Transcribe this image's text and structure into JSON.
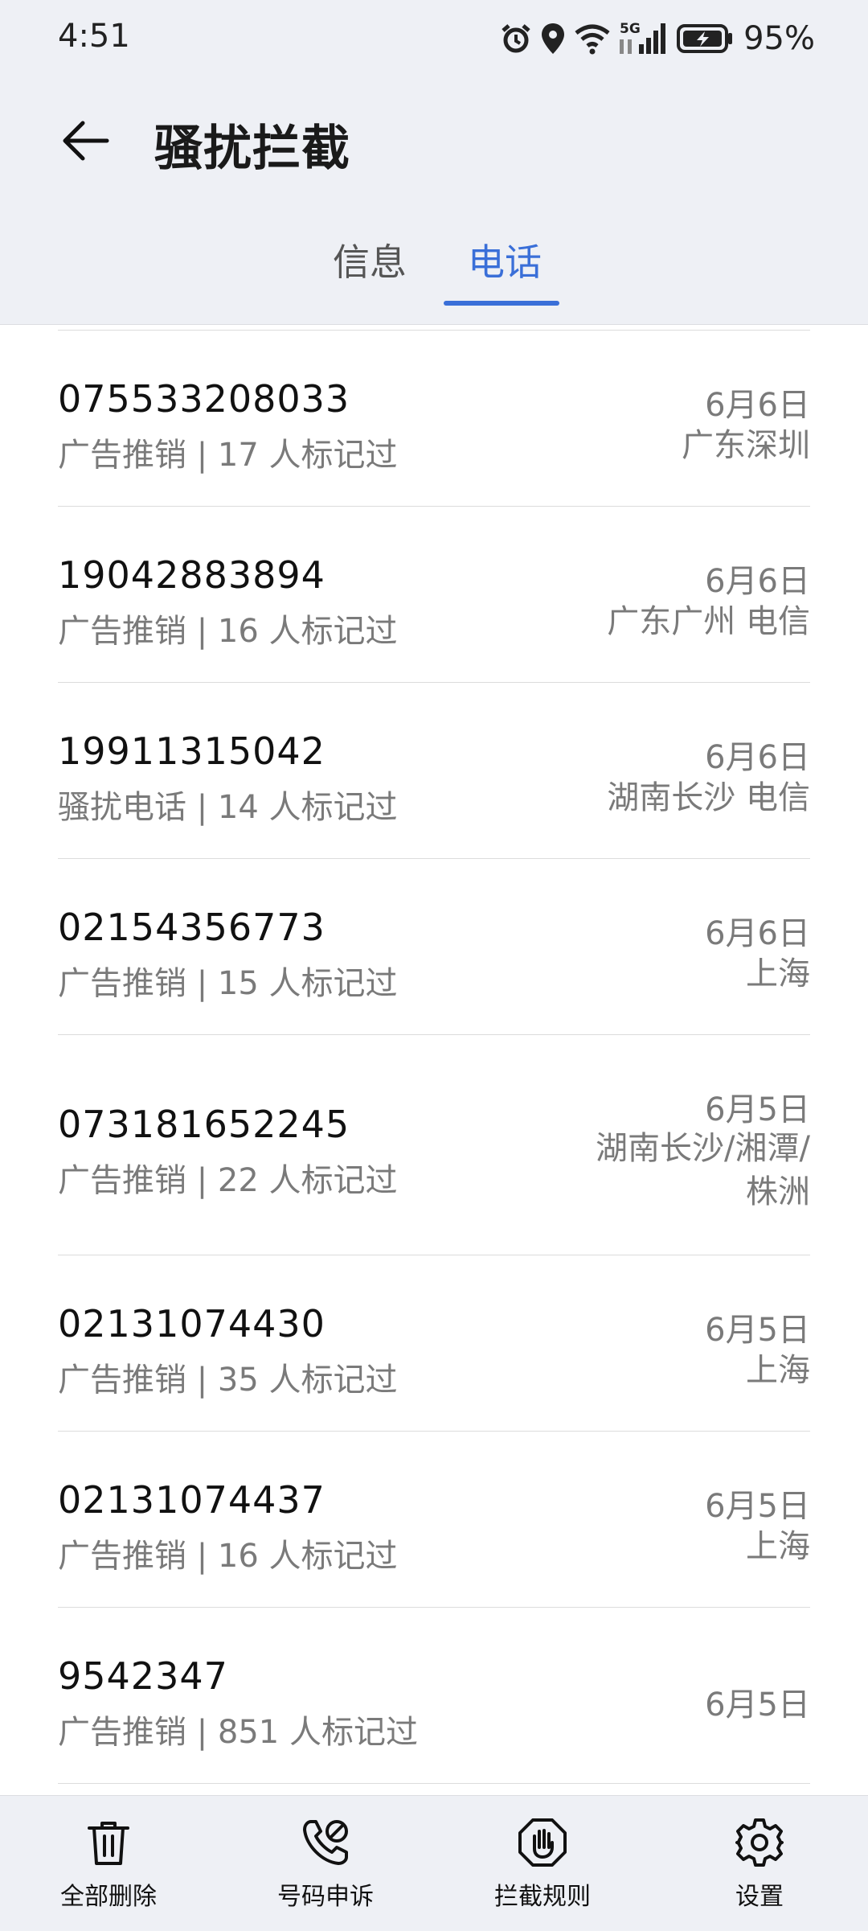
{
  "status": {
    "time": "4:51",
    "battery": "95%",
    "network": "5G"
  },
  "header": {
    "title": "骚扰拦截"
  },
  "tabs": [
    {
      "label": "信息"
    },
    {
      "label": "电话"
    }
  ],
  "active_tab": "电话",
  "calls": [
    {
      "number": "075533208033",
      "desc": "广告推销 | 17 人标记过",
      "date": "6月6日",
      "location": "广东深圳"
    },
    {
      "number": "19042883894",
      "desc": "广告推销 | 16 人标记过",
      "date": "6月6日",
      "location": "广东广州 电信"
    },
    {
      "number": "19911315042",
      "desc": "骚扰电话 | 14 人标记过",
      "date": "6月6日",
      "location": "湖南长沙 电信"
    },
    {
      "number": "02154356773",
      "desc": "广告推销 | 15 人标记过",
      "date": "6月6日",
      "location": "上海"
    },
    {
      "number": "073181652245",
      "desc": "广告推销 | 22 人标记过",
      "date": "6月5日",
      "location": "湖南长沙/湘潭/株洲"
    },
    {
      "number": "02131074430",
      "desc": "广告推销 | 35 人标记过",
      "date": "6月5日",
      "location": "上海"
    },
    {
      "number": "02131074437",
      "desc": "广告推销 | 16 人标记过",
      "date": "6月5日",
      "location": "上海"
    },
    {
      "number": "9542347",
      "desc": "广告推销 | 851 人标记过",
      "date": "6月5日",
      "location": ""
    }
  ],
  "bottom_nav": [
    {
      "label": "全部删除",
      "icon": "trash-icon"
    },
    {
      "label": "号码申诉",
      "icon": "phone-appeal-icon"
    },
    {
      "label": "拦截规则",
      "icon": "hand-stop-icon"
    },
    {
      "label": "设置",
      "icon": "gear-icon"
    }
  ]
}
